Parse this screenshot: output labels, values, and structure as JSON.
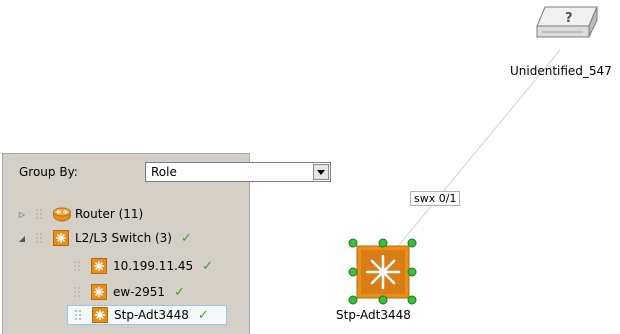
{
  "topology": {
    "link": {
      "label": "swx 0/1"
    },
    "nodes": [
      {
        "label": "Unidentified_547",
        "icon": "unknown-device-icon"
      },
      {
        "label": "Stp-Adt3448",
        "icon": "switch-icon",
        "selected": true
      }
    ]
  },
  "group_panel": {
    "group_by_label": "Group By:",
    "group_by_value": "Role",
    "groups": [
      {
        "label": "Router (11)",
        "icon": "router-icon",
        "expanded": false,
        "status": ""
      },
      {
        "label": "L2/L3 Switch (3)",
        "icon": "switch-icon",
        "expanded": true,
        "status": "ok",
        "children": [
          {
            "label": "10.199.11.45",
            "icon": "switch-icon",
            "status": "ok"
          },
          {
            "label": "ew-2951",
            "icon": "switch-icon",
            "status": "ok"
          },
          {
            "label": "Stp-Adt3448",
            "icon": "switch-icon",
            "status": "ok",
            "selected": true
          }
        ]
      }
    ]
  },
  "colors": {
    "accent_orange": "#e8901c",
    "status_ok": "#3aa020",
    "selection_handles": "#39c039",
    "panel_bg": "#d4d0c8"
  }
}
